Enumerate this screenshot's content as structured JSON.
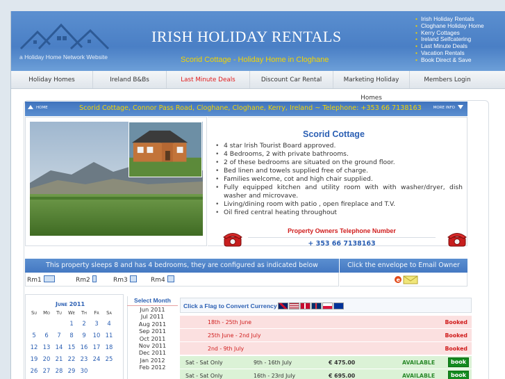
{
  "header": {
    "site_title": "IRISH HOLIDAY RENTALS",
    "subtitle": "Scorid Cottage - Holiday Home in Cloghane",
    "tagline": "a Holiday Home Network Website",
    "side_links": [
      "Irish Holiday Rentals",
      "Cloghane Holiday Home",
      "Kerry Cottages",
      "Ireland Selfcatering",
      "Last Minute Deals",
      "Vacation Rentals",
      "Book Direct & Save"
    ]
  },
  "nav": [
    "Holiday Homes",
    "Ireland B&Bs",
    "Last Minute Deals",
    "Discount Car Rental",
    "Marketing Holiday Homes",
    "Members Login"
  ],
  "infobar": {
    "home": "HOME",
    "address": "Scorid Cottage, Connor Pass Road, Cloghane, Cloghane, Kerry, Ireland ~ Telephone: +353 66 7138163",
    "more_info": "MORE INFO"
  },
  "property": {
    "title": "Scorid Cottage",
    "features": [
      "4 star Irish Tourist Board approved.",
      "4 Bedrooms, 2 with private bathrooms.",
      "2 of these bedrooms are situated on the ground floor.",
      "Bed linen and towels supplied free of charge.",
      "Families welcome, cot and high chair supplied.",
      "Fully equipped kitchen and utility room with with washer/dryer, dish washer and microvave.",
      "Living/dining room with patio , open fireplace and T.V.",
      "Oil fired central heating throughout"
    ],
    "owners_label": "Property Owners Telephone Number",
    "owners_phone": "+ 353 66 7138163"
  },
  "sleeps": {
    "text": "This property sleeps 8 and has 4 bedrooms, they are configured as indicated below",
    "email_text": "Click the envelope to Email Owner",
    "rooms": [
      "Rm1",
      "Rm2",
      "Rm3",
      "Rm4"
    ]
  },
  "calendar": {
    "title": "June 2011",
    "weekdays": [
      "Su",
      "Mo",
      "Tu",
      "We",
      "Th",
      "Fr",
      "Sa"
    ],
    "weeks": [
      [
        "",
        "",
        "",
        "1",
        "2",
        "3",
        "4"
      ],
      [
        "5",
        "6",
        "7",
        "8",
        "9",
        "10",
        "11"
      ],
      [
        "12",
        "13",
        "14",
        "15",
        "16",
        "17",
        "18"
      ],
      [
        "19",
        "20",
        "21",
        "22",
        "23",
        "24",
        "25"
      ],
      [
        "26",
        "27",
        "28",
        "29",
        "30",
        "",
        ""
      ]
    ]
  },
  "months": {
    "heading": "Select Month",
    "items": [
      "Jun 2011",
      "Jul 2011",
      "Aug 2011",
      "Sep 2011",
      "Oct 2011",
      "Nov 2011",
      "Dec 2011",
      "Jan 2012",
      "Feb 2012"
    ]
  },
  "rates": {
    "flags_label": "Click a Flag to Convert Currency",
    "booked": [
      {
        "dates": "18th - 25th June",
        "status": "Booked"
      },
      {
        "dates": "25th June - 2nd July",
        "status": "Booked"
      },
      {
        "dates": "2nd - 9th July",
        "status": "Booked"
      }
    ],
    "available": [
      {
        "type": "Sat - Sat Only",
        "dates": "9th - 16th July",
        "price": "€ 475.00",
        "status": "AVAILABLE",
        "button": "book"
      },
      {
        "type": "Sat - Sat Only",
        "dates": "16th - 23rd July",
        "price": "€ 695.00",
        "status": "AVAILABLE",
        "button": "book"
      }
    ]
  },
  "colors": {
    "header_blue": "#4a7fc5",
    "title_blue": "#2b5fb3",
    "accent_yellow": "#f3d400",
    "booked_red": "#d01c1c",
    "available_green": "#2c8a2c"
  }
}
